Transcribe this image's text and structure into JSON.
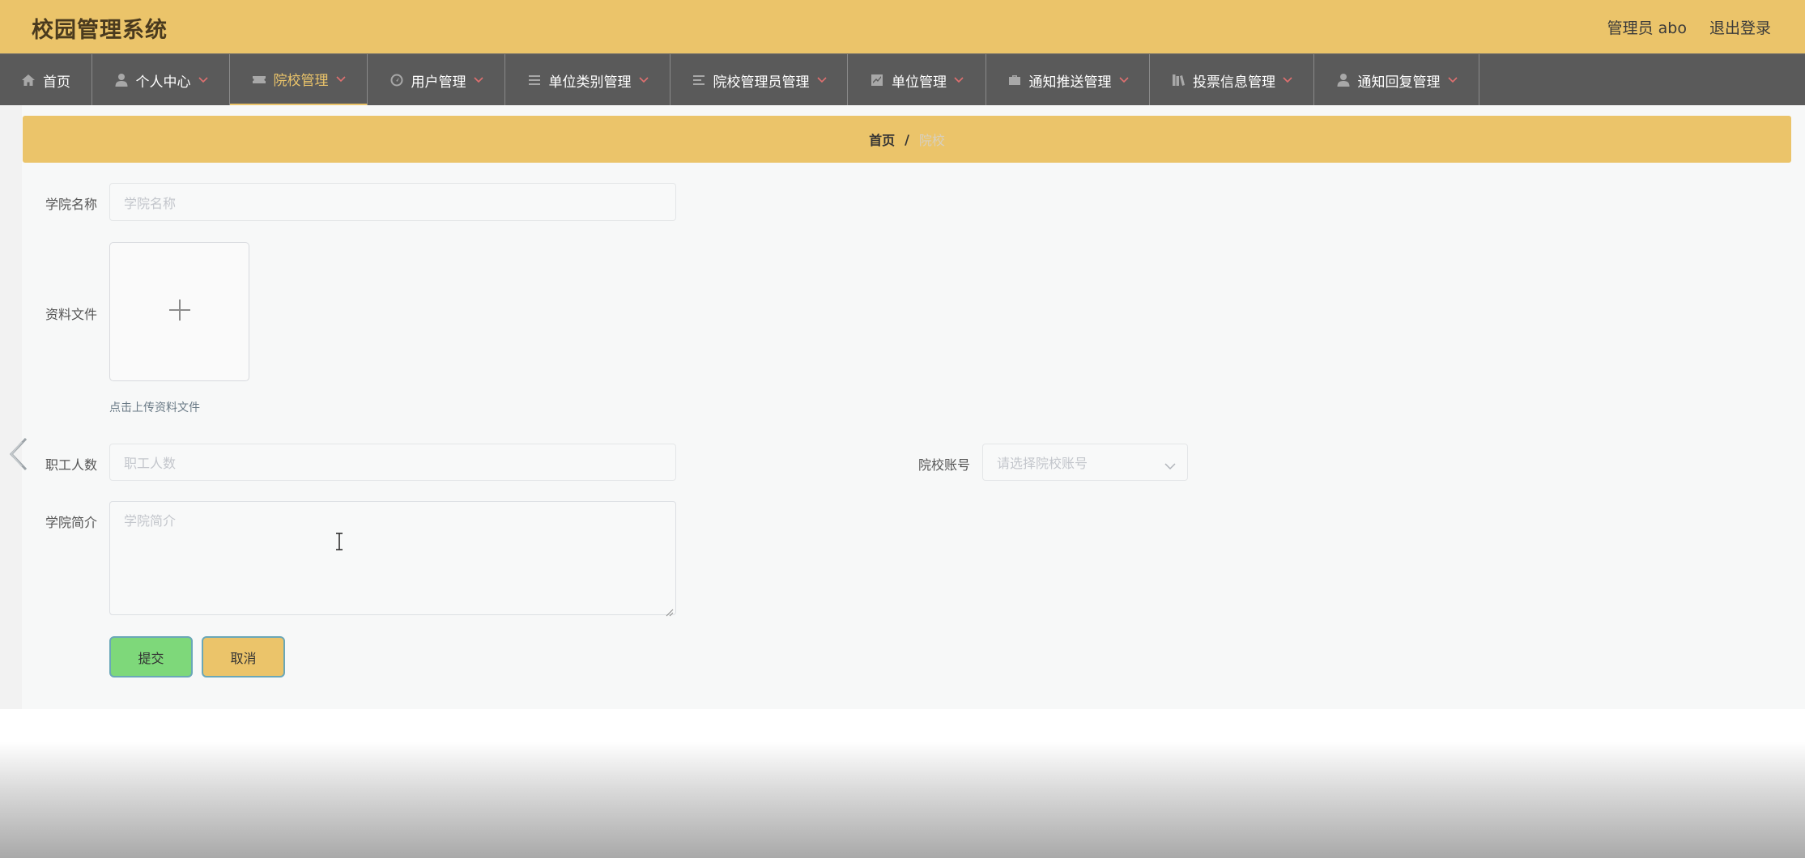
{
  "header": {
    "title": "校园管理系统",
    "user": "管理员 abo",
    "logout": "退出登录"
  },
  "nav": {
    "items": [
      {
        "label": "首页",
        "icon": "home-icon"
      },
      {
        "label": "个人中心",
        "icon": "person-icon"
      },
      {
        "label": "院校管理",
        "icon": "ticket-icon",
        "active": true
      },
      {
        "label": "用户管理",
        "icon": "gauge-icon"
      },
      {
        "label": "单位类别管理",
        "icon": "list-icon"
      },
      {
        "label": "院校管理员管理",
        "icon": "list-icon"
      },
      {
        "label": "单位管理",
        "icon": "chart-icon"
      },
      {
        "label": "通知推送管理",
        "icon": "briefcase-icon"
      },
      {
        "label": "投票信息管理",
        "icon": "books-icon"
      },
      {
        "label": "通知回复管理",
        "icon": "person-icon"
      }
    ]
  },
  "breadcrumb": {
    "home": "首页",
    "separator": "/",
    "current": "院校"
  },
  "form": {
    "college_name": {
      "label": "学院名称",
      "placeholder": "学院名称"
    },
    "file": {
      "label": "资料文件",
      "hint": "点击上传资料文件"
    },
    "staff_count": {
      "label": "职工人数",
      "placeholder": "职工人数"
    },
    "account": {
      "label": "院校账号",
      "placeholder": "请选择院校账号"
    },
    "intro": {
      "label": "学院简介",
      "placeholder": "学院简介"
    },
    "submit": "提交",
    "cancel": "取消"
  },
  "colors": {
    "accent": "#ebc46a",
    "nav_bg": "#5a5a5a",
    "submit_bg": "#7ed87a"
  }
}
